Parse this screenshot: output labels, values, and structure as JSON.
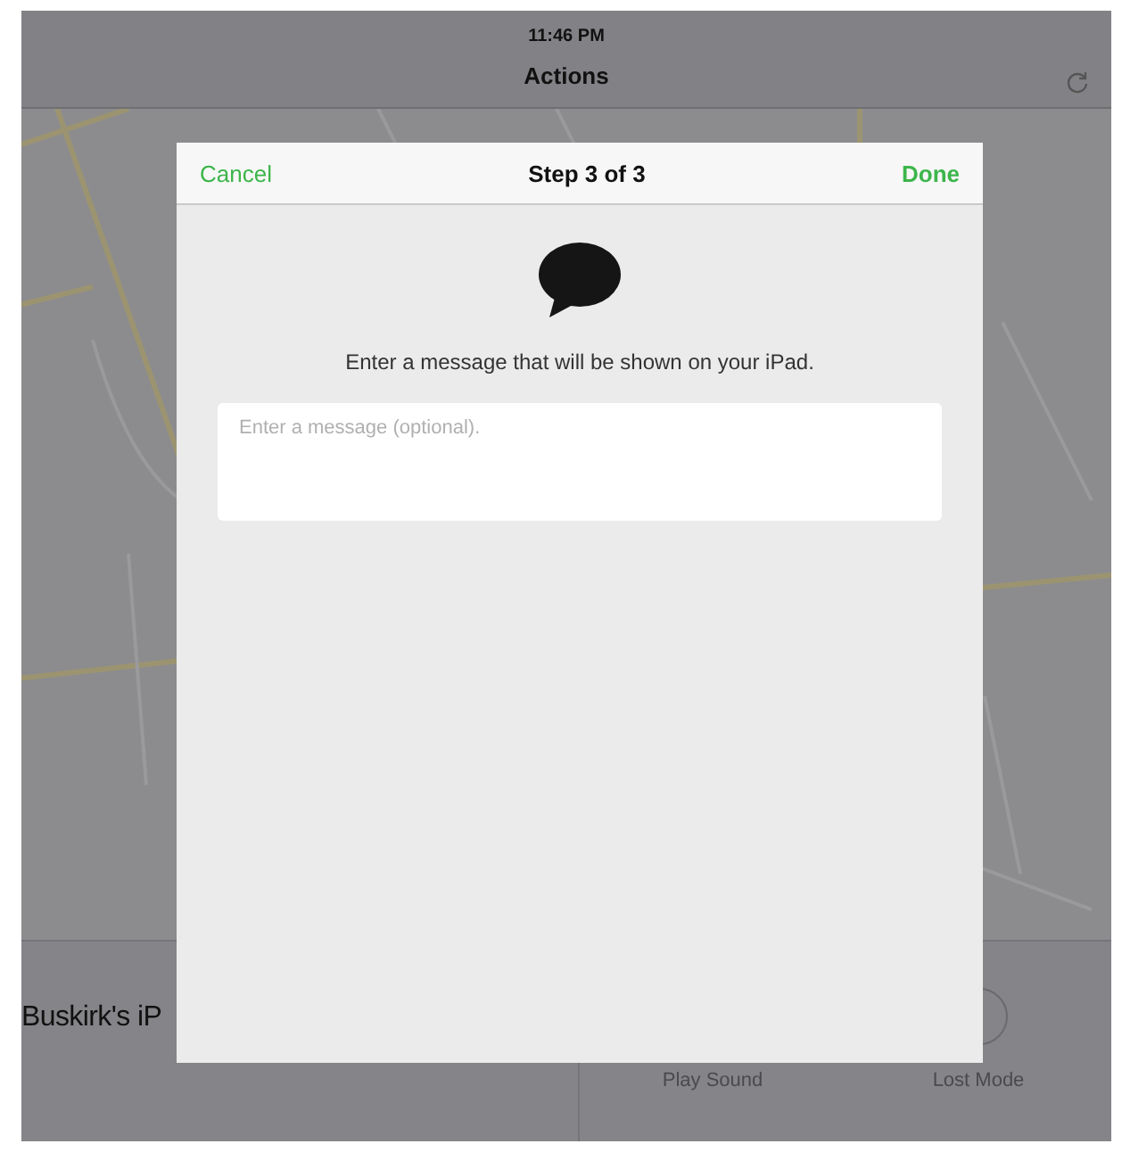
{
  "status_bar": {
    "time": "11:46 PM"
  },
  "nav_bar": {
    "title": "Actions"
  },
  "device_panel": {
    "name": "Buskirk's iP",
    "actions": [
      {
        "label": "Play Sound"
      },
      {
        "label": "Lost Mode"
      }
    ]
  },
  "dialog": {
    "cancel": "Cancel",
    "title": "Step 3 of 3",
    "done": "Done",
    "prompt": "Enter a message that will be shown on your iPad.",
    "message_field": {
      "placeholder": "Enter a message (optional)."
    }
  }
}
